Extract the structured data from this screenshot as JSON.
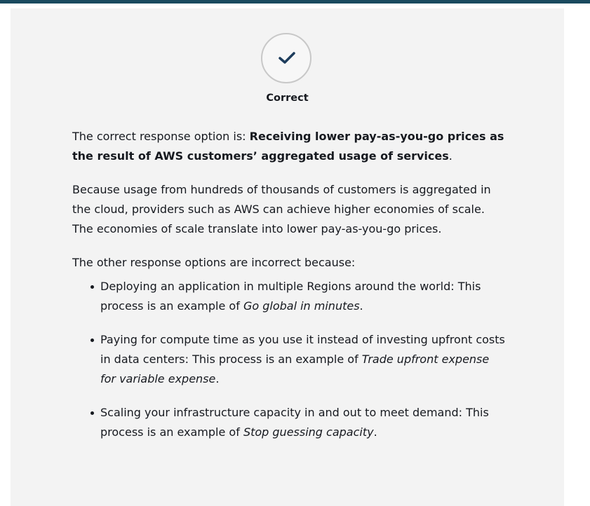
{
  "header": {
    "accent_color": "#1a4a5f"
  },
  "status": {
    "label": "Correct",
    "icon": "checkmark-icon",
    "icon_color": "#1d3c5c"
  },
  "answer": {
    "prefix": "The correct response option is: ",
    "option": "Receiving lower pay-as-you-go prices as the result of AWS customers’ aggregated usage of services",
    "suffix": "."
  },
  "explanation": "Because usage from hundreds of thousands of customers is aggregated in the cloud, providers such as AWS can achieve higher economies of scale. The economies of scale translate into lower pay-as-you-go prices.",
  "incorrect_intro": "The other response options are incorrect because:",
  "incorrect_options": [
    {
      "text": "Deploying an application in multiple Regions around the world: This process is an example of ",
      "emphasis": "Go global in minutes",
      "end": "."
    },
    {
      "text": "Paying for compute time as you use it instead of investing upfront costs in data centers: This process is an example of ",
      "emphasis": "Trade upfront expense for variable expense",
      "end": "."
    },
    {
      "text": "Scaling your infrastructure capacity in and out to meet demand: This process is an example of ",
      "emphasis": "Stop guessing capacity",
      "end": "."
    }
  ]
}
